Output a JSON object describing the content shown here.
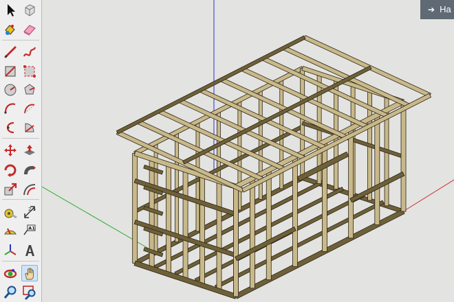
{
  "toolbar": {
    "tools": [
      {
        "name": "select-tool-icon",
        "interactable": true
      },
      {
        "name": "component-tool-icon",
        "interactable": true
      },
      {
        "name": "paint-bucket-tool-icon",
        "interactable": true
      },
      {
        "name": "eraser-tool-icon",
        "interactable": true
      },
      {
        "name": "line-tool-icon",
        "interactable": true
      },
      {
        "name": "freehand-tool-icon",
        "interactable": true
      },
      {
        "name": "rectangle-tool-icon",
        "interactable": true
      },
      {
        "name": "rotated-rectangle-tool-icon",
        "interactable": true
      },
      {
        "name": "circle-tool-icon",
        "interactable": true
      },
      {
        "name": "polygon-tool-icon",
        "interactable": true
      },
      {
        "name": "arc-tool-icon",
        "interactable": true
      },
      {
        "name": "two-point-arc-tool-icon",
        "interactable": true
      },
      {
        "name": "three-point-arc-tool-icon",
        "interactable": true
      },
      {
        "name": "pie-tool-icon",
        "interactable": true
      },
      {
        "name": "move-tool-icon",
        "interactable": true
      },
      {
        "name": "push-pull-tool-icon",
        "interactable": true
      },
      {
        "name": "rotate-tool-icon",
        "interactable": true
      },
      {
        "name": "follow-me-tool-icon",
        "interactable": true
      },
      {
        "name": "scale-tool-icon",
        "interactable": true
      },
      {
        "name": "offset-tool-icon",
        "interactable": true
      },
      {
        "name": "tape-measure-tool-icon",
        "interactable": true
      },
      {
        "name": "dimension-tool-icon",
        "interactable": true
      },
      {
        "name": "protractor-tool-icon",
        "interactable": true
      },
      {
        "name": "text-tool-icon",
        "interactable": true
      },
      {
        "name": "axes-tool-icon",
        "interactable": true
      },
      {
        "name": "3d-text-tool-icon",
        "interactable": true
      },
      {
        "name": "orbit-tool-icon",
        "interactable": true
      },
      {
        "name": "pan-tool-icon",
        "interactable": true
      },
      {
        "name": "zoom-tool-icon",
        "interactable": true
      },
      {
        "name": "zoom-window-tool-icon",
        "interactable": true
      }
    ],
    "active_tool": "pan-tool-icon",
    "text_tool_label": "A1"
  },
  "hint_panel": {
    "label": "Ha",
    "icon": "arrow-right-icon"
  },
  "colors": {
    "toolbar_bg": "#efefef",
    "viewport_bg": "#e3e3e1",
    "axis_blue": "#2b2fd1",
    "axis_red": "#d12a2a",
    "axis_green": "#2faa2f",
    "wood_light": "#c9b98a",
    "wood_dark": "#6e6038",
    "wood_edge": "#2a2416",
    "hint_bg": "#5f6a75"
  }
}
